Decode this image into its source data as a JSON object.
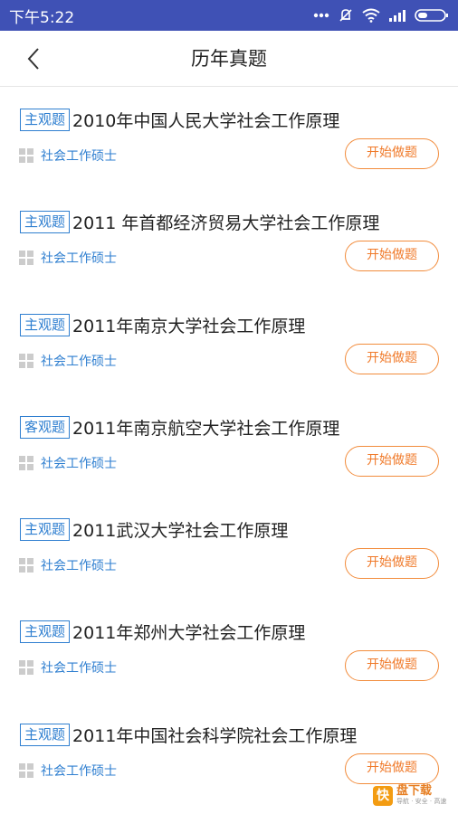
{
  "statusbar": {
    "time": "下午5:22"
  },
  "navbar": {
    "title": "历年真题"
  },
  "items": [
    {
      "tag": "主观题",
      "title": "2010年中国人民大学社会工作原理",
      "category": "社会工作硕士",
      "button": "开始做题"
    },
    {
      "tag": "主观题",
      "title": "2011 年首都经济贸易大学社会工作原理",
      "category": "社会工作硕士",
      "button": "开始做题"
    },
    {
      "tag": "主观题",
      "title": "2011年南京大学社会工作原理",
      "category": "社会工作硕士",
      "button": "开始做题"
    },
    {
      "tag": "客观题",
      "title": "2011年南京航空大学社会工作原理",
      "category": "社会工作硕士",
      "button": "开始做题"
    },
    {
      "tag": "主观题",
      "title": "2011武汉大学社会工作原理",
      "category": "社会工作硕士",
      "button": "开始做题"
    },
    {
      "tag": "主观题",
      "title": "2011年郑州大学社会工作原理",
      "category": "社会工作硕士",
      "button": "开始做题"
    },
    {
      "tag": "主观题",
      "title": "2011年中国社会科学院社会工作原理",
      "category": "社会工作硕士",
      "button": "开始做题"
    }
  ],
  "watermark": {
    "logo": "快",
    "main": "盘下载",
    "sub": "导航 · 安全 · 高速"
  },
  "colors": {
    "statusbar": "#3f51b5",
    "tag": "#2f7fd0",
    "button": "#f07a2a"
  }
}
